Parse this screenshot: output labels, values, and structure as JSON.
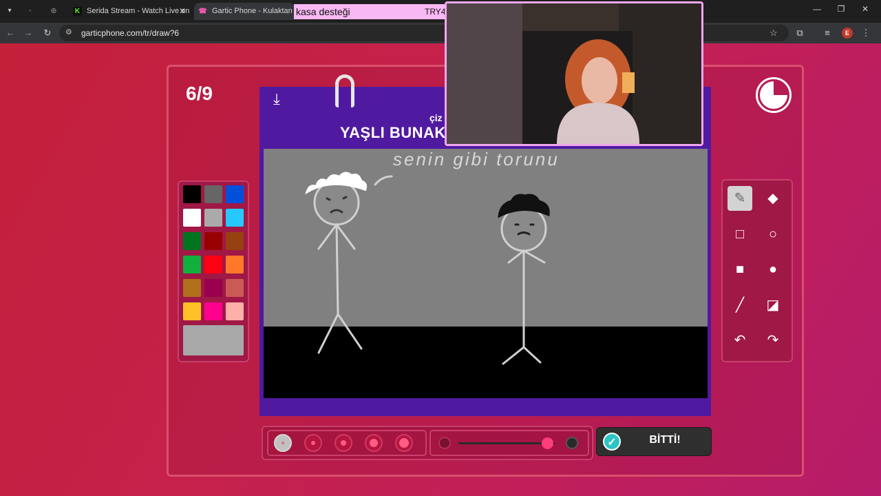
{
  "browser": {
    "tabs": [
      {
        "title": "Serida Stream - Watch Live on K",
        "active": false
      },
      {
        "title": "Gartic Phone - Kulaktan Kulağ",
        "active": true
      }
    ],
    "url": "garticphone.com/tr/draw?6",
    "profile_initial": "E"
  },
  "overlay": {
    "banner_left": "kasa desteği",
    "banner_right": "TRY4"
  },
  "game": {
    "round": "6/9",
    "hint_subtitle": "çiz",
    "prompt": "YAŞLI BUNAK",
    "canvas_text": "senin gibi torunu",
    "done_label": "BİTTİ!",
    "selected_color": "#a8a8a8",
    "palette": [
      "#000000",
      "#666666",
      "#0050dc",
      "#ffffff",
      "#aaaaaa",
      "#26c9ff",
      "#017420",
      "#990000",
      "#964112",
      "#11b03c",
      "#ff0013",
      "#ff7829",
      "#b0701c",
      "#99004e",
      "#cb5a57",
      "#ffc126",
      "#ff008f",
      "#feafa8"
    ],
    "brush_size_index": 0,
    "opacity_fraction": 0.92
  }
}
